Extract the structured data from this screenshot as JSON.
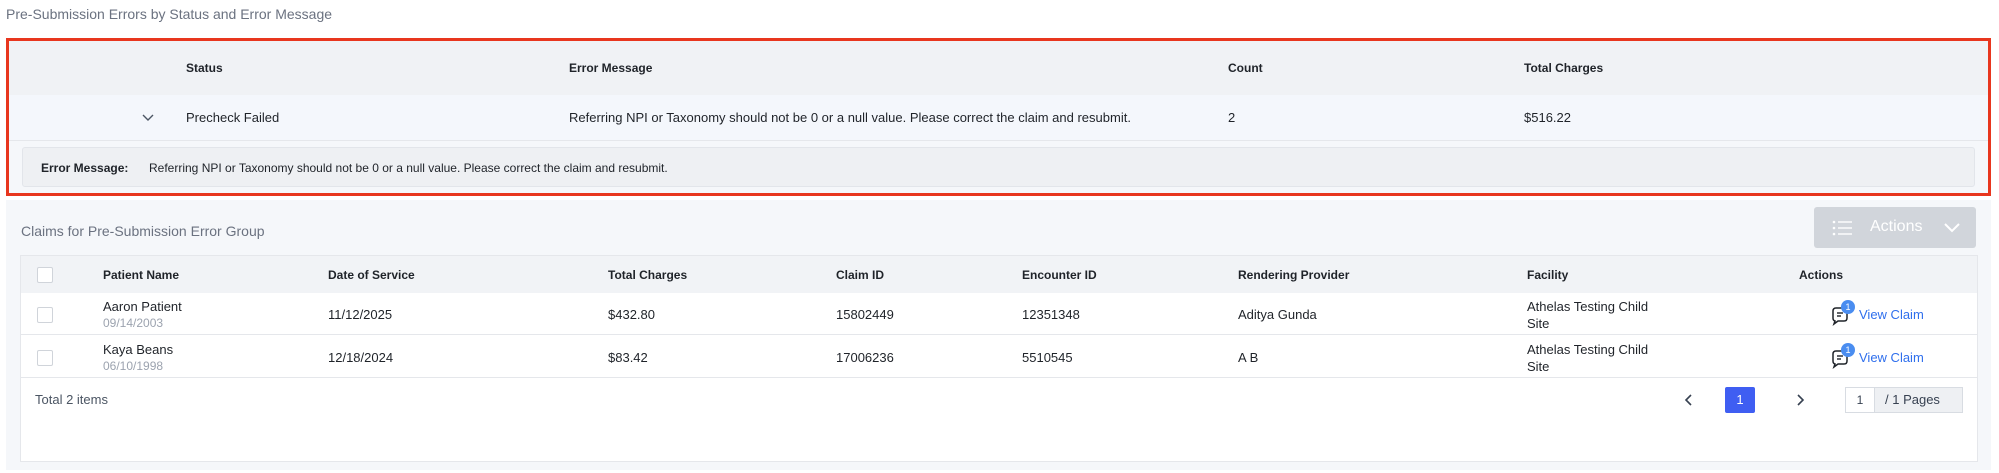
{
  "section_title": "Pre-Submission Errors by Status and Error Message",
  "group_table": {
    "headers": {
      "status": "Status",
      "error_message": "Error Message",
      "count": "Count",
      "total_charges": "Total Charges"
    },
    "row": {
      "status": "Precheck Failed",
      "error_message": "Referring NPI or Taxonomy should not be 0 or a null value. Please correct the claim and resubmit.",
      "count": "2",
      "total_charges": "$516.22"
    },
    "expanded": {
      "label": "Error Message:",
      "value": "Referring NPI or Taxonomy should not be 0 or a null value. Please correct the claim and resubmit."
    }
  },
  "claims": {
    "title": "Claims for Pre-Submission Error Group",
    "actions_button": "Actions",
    "headers": {
      "patient_name": "Patient Name",
      "date_of_service": "Date of Service",
      "total_charges": "Total Charges",
      "claim_id": "Claim ID",
      "encounter_id": "Encounter ID",
      "rendering_provider": "Rendering Provider",
      "facility": "Facility",
      "actions": "Actions"
    },
    "rows": [
      {
        "patient_name": "Aaron Patient",
        "dob": "09/14/2003",
        "date_of_service": "11/12/2025",
        "total_charges": "$432.80",
        "claim_id": "15802449",
        "encounter_id": "12351348",
        "rendering_provider": "Aditya Gunda",
        "facility_line1": "Athelas Testing Child",
        "facility_line2": "Site",
        "badge": "1",
        "view_label": "View Claim"
      },
      {
        "patient_name": "Kaya Beans",
        "dob": "06/10/1998",
        "date_of_service": "12/18/2024",
        "total_charges": "$83.42",
        "claim_id": "17006236",
        "encounter_id": "5510545",
        "rendering_provider": "A B",
        "facility_line1": "Athelas Testing Child",
        "facility_line2": "Site",
        "badge": "1",
        "view_label": "View Claim"
      }
    ],
    "footer": {
      "total_items": "Total 2 items",
      "current_page": "1",
      "page_input": "1",
      "pages_label": "/ 1 Pages"
    }
  },
  "colors": {
    "highlight_border": "#e8361e",
    "page_active": "#3f5ef2",
    "link": "#2f6fed"
  }
}
